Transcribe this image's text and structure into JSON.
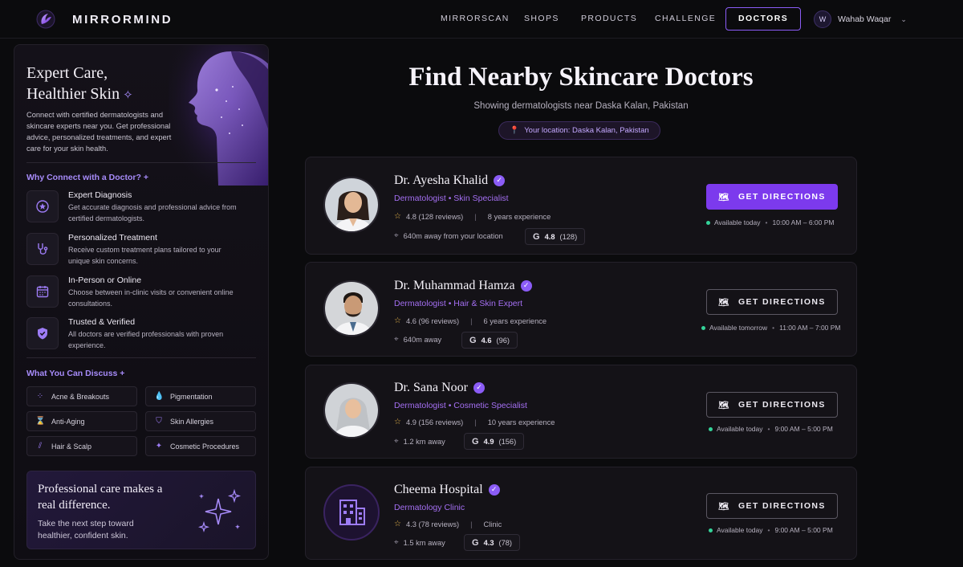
{
  "nav": {
    "brand": "MIRRORMIND",
    "links": [
      "MIRRORSCAN",
      "SHOPS",
      "PRODUCTS",
      "CHALLENGE",
      "DOCTORS"
    ],
    "active_link": "DOCTORS",
    "user_initial": "W",
    "user_name": "Wahab Waqar"
  },
  "sidebar": {
    "title_line1": "Expert Care,",
    "title_line2": "Healthier Skin",
    "description": "Connect with certified dermatologists and skincare experts near you. Get professional advice, personalized treatments, and expert care for your skin health.",
    "why_title": "Why Connect with a Doctor? +",
    "features": [
      {
        "title": "Expert Diagnosis",
        "desc": "Get accurate diagnosis and professional advice from certified dermatologists.",
        "icon": "star-badge-icon"
      },
      {
        "title": "Personalized Treatment",
        "desc": "Receive custom treatment plans tailored to your unique skin concerns.",
        "icon": "stethoscope-icon"
      },
      {
        "title": "In-Person or Online",
        "desc": "Choose between in-clinic visits or convenient online consultations.",
        "icon": "calendar-icon"
      },
      {
        "title": "Trusted & Verified",
        "desc": "All doctors are verified professionals with proven experience.",
        "icon": "shield-check-icon"
      }
    ],
    "discuss_title": "What You Can Discuss +",
    "topics": [
      {
        "label": "Acne & Breakouts",
        "icon": "acne-icon"
      },
      {
        "label": "Pigmentation",
        "icon": "droplet-icon"
      },
      {
        "label": "Anti-Aging",
        "icon": "hourglass-icon"
      },
      {
        "label": "Skin Allergies",
        "icon": "shield-icon"
      },
      {
        "label": "Hair & Scalp",
        "icon": "hair-icon"
      },
      {
        "label": "Cosmetic Procedures",
        "icon": "sparkle-icon"
      }
    ],
    "promo_title": "Professional care makes a real difference.",
    "promo_desc": "Take the next step toward healthier, confident skin."
  },
  "main": {
    "title": "Find Nearby Skincare Doctors",
    "subtitle": "Showing dermatologists near Daska Kalan, Pakistan",
    "location_pill": "Your location: Daska Kalan, Pakistan"
  },
  "doctors": [
    {
      "name": "Dr. Ayesha Khalid",
      "specialty": "Dermatologist • Skin Specialist",
      "rating": "4.8 (128 reviews)",
      "experience": "8 years experience",
      "distance": "640m away from your location",
      "g_rating": "4.8",
      "g_count": "(128)",
      "button": "GET DIRECTIONS",
      "primary": true,
      "availability": "Available today",
      "hours": "10:00 AM – 6:00 PM"
    },
    {
      "name": "Dr. Muhammad Hamza",
      "specialty": "Dermatologist • Hair & Skin Expert",
      "rating": "4.6 (96 reviews)",
      "experience": "6 years experience",
      "distance": "640m away",
      "g_rating": "4.6",
      "g_count": "(96)",
      "button": "GET DIRECTIONS",
      "primary": false,
      "availability": "Available tomorrow",
      "hours": "11:00 AM – 7:00 PM"
    },
    {
      "name": "Dr. Sana Noor",
      "specialty": "Dermatologist • Cosmetic Specialist",
      "rating": "4.9 (156 reviews)",
      "experience": "10 years experience",
      "distance": "1.2 km away",
      "g_rating": "4.9",
      "g_count": "(156)",
      "button": "GET DIRECTIONS",
      "primary": false,
      "availability": "Available today",
      "hours": "9:00 AM – 5:00 PM"
    },
    {
      "name": "Cheema Hospital",
      "specialty": "Dermatology Clinic",
      "rating": "4.3 (78 reviews)",
      "experience": "Clinic",
      "distance": "1.5 km away",
      "g_rating": "4.3",
      "g_count": "(78)",
      "button": "GET DIRECTIONS",
      "primary": false,
      "availability": "Available today",
      "hours": "9:00 AM – 5:00 PM"
    }
  ],
  "colors": {
    "accent": "#8b5cf6",
    "background": "#0b0b0d",
    "available": "#34d399"
  }
}
